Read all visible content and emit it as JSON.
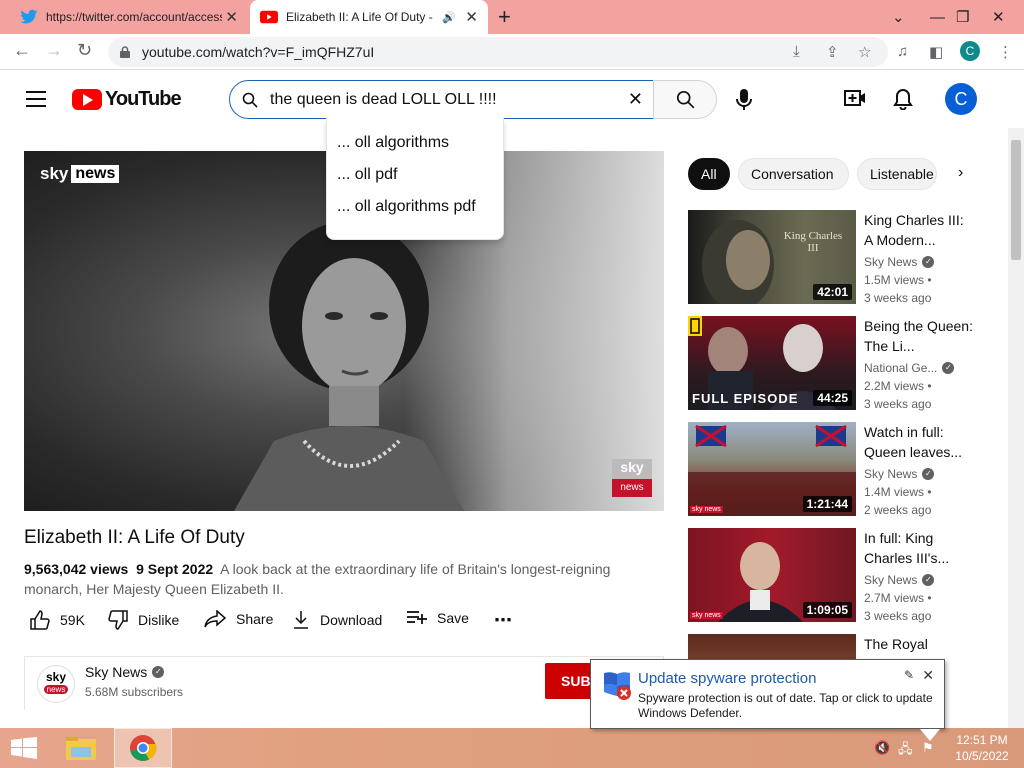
{
  "browser": {
    "tabs": [
      {
        "title": "https://twitter.com/account/access",
        "favicon": "twitter-icon"
      },
      {
        "title": "Elizabeth II: A Life Of Duty - YouTube",
        "favicon": "youtube-icon"
      }
    ],
    "url": "youtube.com/watch?v=F_imQFHZ7uI",
    "profile_initial": "C"
  },
  "youtube": {
    "logo_text": "YouTube",
    "search_query": "the queen is dead LOLL OLL !!!!",
    "suggestions": [
      "... oll algorithms",
      "... oll pdf",
      "... oll algorithms pdf"
    ],
    "avatar_initial": "C",
    "player": {
      "watermark_sky": "sky",
      "watermark_news": "news",
      "bug_sky": "sky",
      "bug_news": "news"
    },
    "video": {
      "title": "Elizabeth II: A Life Of Duty",
      "views": "9,563,042 views",
      "date": "9 Sept 2022",
      "description": "A look back at the extraordinary life of Britain's longest-reigning monarch, Her Majesty Queen Elizabeth II."
    },
    "actions": {
      "likes": "59K",
      "dislike": "Dislike",
      "share": "Share",
      "download": "Download",
      "save": "Save"
    },
    "channel": {
      "name": "Sky News",
      "subscribers": "5.68M subscribers",
      "subscribe_label": "SUBSCRIBE",
      "avatar_top": "sky",
      "avatar_bottom": "news"
    },
    "chips": [
      "All",
      "Conversation",
      "Listenable"
    ],
    "recommendations": [
      {
        "title": "King Charles III: A Modern...",
        "channel": "Sky News",
        "views": "1.5M views •",
        "ago": "3 weeks ago",
        "duration": "42:01",
        "thumb_text": "King Charles III"
      },
      {
        "title": "Being the Queen: The Li...",
        "channel": "National Ge...",
        "views": "2.2M views •",
        "ago": "3 weeks ago",
        "duration": "44:25",
        "thumb_text": "FULL EPISODE"
      },
      {
        "title": "Watch in full: Queen leaves...",
        "channel": "Sky News",
        "views": "1.4M views •",
        "ago": "2 weeks ago",
        "duration": "1:21:44",
        "thumb_text": "sky news"
      },
      {
        "title": "In full: King Charles III's...",
        "channel": "Sky News",
        "views": "2.7M views •",
        "ago": "3 weeks ago",
        "duration": "1:09:05",
        "thumb_text": "sky news"
      },
      {
        "title": "The Royal",
        "channel": "",
        "views": "",
        "ago": "",
        "duration": "",
        "thumb_text": ""
      }
    ]
  },
  "notification": {
    "title": "Update spyware protection",
    "text": "Spyware protection is out of date. Tap or click to update Windows Defender."
  },
  "taskbar": {
    "time": "12:51 PM",
    "date": "10/5/2022"
  },
  "colors": {
    "tabbar": "#f3a39f",
    "yt_red": "#ff0000",
    "taskbar": "#e0a080",
    "link_blue": "#1c5bab"
  }
}
